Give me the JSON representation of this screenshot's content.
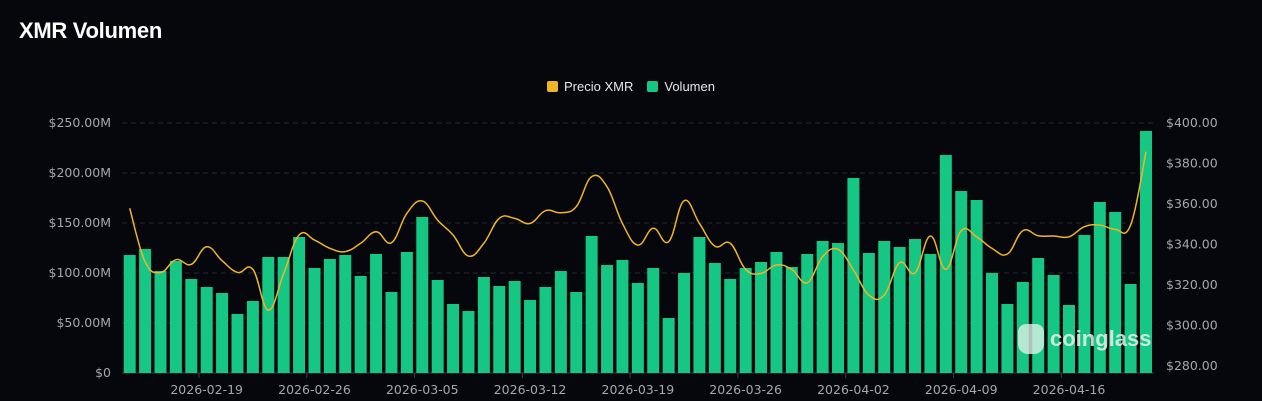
{
  "title": "XMR Volumen",
  "legend": [
    {
      "label": "Precio XMR",
      "color": "#f0b429"
    },
    {
      "label": "Volumen",
      "color": "#16c784"
    }
  ],
  "watermark": "coinglass",
  "chart_data": {
    "type": "bar",
    "title": "XMR Volumen",
    "x": [
      "2026-02-14",
      "2026-02-15",
      "2026-02-16",
      "2026-02-17",
      "2026-02-18",
      "2026-02-19",
      "2026-02-20",
      "2026-02-21",
      "2026-02-22",
      "2026-02-23",
      "2026-02-24",
      "2026-02-25",
      "2026-02-26",
      "2026-02-27",
      "2026-02-28",
      "2026-03-01",
      "2026-03-02",
      "2026-03-03",
      "2026-03-04",
      "2026-03-05",
      "2026-03-06",
      "2026-03-07",
      "2026-03-08",
      "2026-03-09",
      "2026-03-10",
      "2026-03-11",
      "2026-03-12",
      "2026-03-13",
      "2026-03-14",
      "2026-03-15",
      "2026-03-16",
      "2026-03-17",
      "2026-03-18",
      "2026-03-19",
      "2026-03-20",
      "2026-03-21",
      "2026-03-22",
      "2026-03-23",
      "2026-03-24",
      "2026-03-25",
      "2026-03-26",
      "2026-03-27",
      "2026-03-28",
      "2026-03-29",
      "2026-03-30",
      "2026-03-31",
      "2026-04-01",
      "2026-04-02",
      "2026-04-03",
      "2026-04-04",
      "2026-04-05",
      "2026-04-06",
      "2026-04-07",
      "2026-04-08",
      "2026-04-09",
      "2026-04-10",
      "2026-04-11",
      "2026-04-12",
      "2026-04-13",
      "2026-04-14",
      "2026-04-15",
      "2026-04-16",
      "2026-04-17",
      "2026-04-18",
      "2026-04-19",
      "2026-04-20",
      "2026-04-21"
    ],
    "x_tick_labels": [
      "2026-02-19",
      "2026-02-26",
      "2026-03-05",
      "2026-03-12",
      "2026-03-19",
      "2026-03-26",
      "2026-04-02",
      "2026-04-09",
      "2026-04-16"
    ],
    "series": [
      {
        "name": "Volumen",
        "type": "bar",
        "axis": "left",
        "unit": "USD millions",
        "color": "#16c784",
        "values": [
          118,
          124,
          102,
          112,
          94,
          86,
          80,
          59,
          72,
          116,
          116,
          136,
          105,
          114,
          118,
          97,
          119,
          81,
          121,
          156,
          93,
          69,
          62,
          96,
          87,
          92,
          73,
          86,
          102,
          81,
          137,
          108,
          113,
          90,
          105,
          55,
          100,
          136,
          110,
          94,
          105,
          111,
          121,
          106,
          119,
          132,
          130,
          195,
          120,
          132,
          126,
          134,
          119,
          218,
          182,
          173,
          100,
          69,
          91,
          115,
          98,
          68,
          138,
          171,
          161,
          89,
          242
        ]
      },
      {
        "name": "Precio XMR",
        "type": "line",
        "axis": "right",
        "unit": "USD",
        "color": "#f0b429",
        "values": [
          357.9,
          331.5,
          326.2,
          332.5,
          330.2,
          338.9,
          332.0,
          326.2,
          327.7,
          307.6,
          325.7,
          344.7,
          342.2,
          338.1,
          336.5,
          340.6,
          346.3,
          340.9,
          355.4,
          361.5,
          352.0,
          344.7,
          334.3,
          340.6,
          352.9,
          352.9,
          350.4,
          356.7,
          355.7,
          358.7,
          373.5,
          368.5,
          350.4,
          339.7,
          348.0,
          341.4,
          361.6,
          350.4,
          339.2,
          340.6,
          327.7,
          325.7,
          329.9,
          327.7,
          321.1,
          334.0,
          337.6,
          327.4,
          315.0,
          315.0,
          331.0,
          326.0,
          344.2,
          327.7,
          346.8,
          343.8,
          338.1,
          335.3,
          346.8,
          344.3,
          344.2,
          343.8,
          348.8,
          349.6,
          347.5,
          349.6,
          385.8
        ]
      }
    ],
    "y_left": {
      "ylim": [
        0,
        250
      ],
      "ticks": [
        "$0",
        "$50.00M",
        "$100.00M",
        "$150.00M",
        "$200.00M",
        "$250.00M"
      ]
    },
    "y_right": {
      "ylim": [
        280,
        400
      ],
      "ticks": [
        "$280.00",
        "$300.00",
        "$320.00",
        "$340.00",
        "$360.00",
        "$380.00",
        "$400.00"
      ]
    },
    "grid": true,
    "legend_position": "top-center"
  }
}
